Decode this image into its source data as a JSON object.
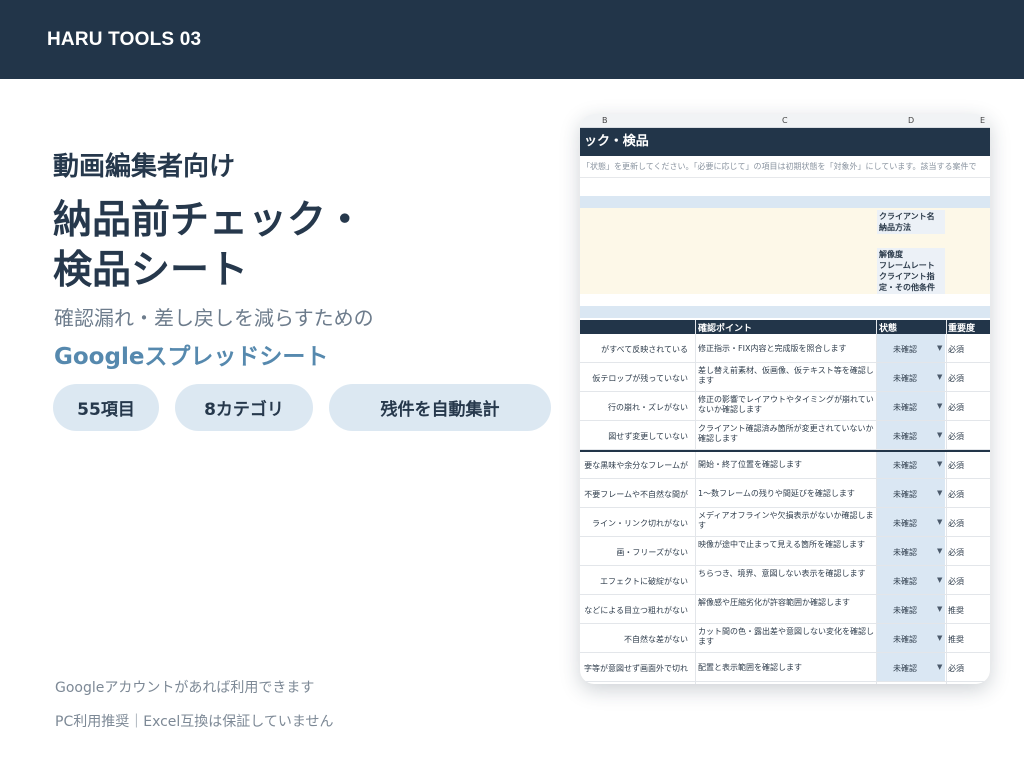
{
  "brand": "HARU TOOLS 03",
  "hero": {
    "subtitle": "動画編集者向け",
    "title_line1": "納品前チェック・",
    "title_line2": "検品シート",
    "lead": "確認漏れ・差し戻しを減らすための",
    "lead_accent": "Googleスプレッドシート"
  },
  "pills": [
    "55項目",
    "8カテゴリ",
    "残件を自動集計"
  ],
  "footer": {
    "line1": "Googleアカウントがあれば利用できます",
    "line2": "PC利用推奨｜Excel互換は保証していません"
  },
  "sheet": {
    "col_letters": [
      "B",
      "C",
      "D",
      "E"
    ],
    "banner": "ック・検品",
    "note": "「状態」を更新してください。「必要に応じて」の項目は初期状態を「対象外」にしています。該当する案件で",
    "meta": [
      "クライアント名",
      "納品方法",
      "解像度",
      "フレームレート",
      "クライアント指定・その他条件"
    ],
    "headers": {
      "point": "確認ポイント",
      "status": "状態",
      "importance": "重要度"
    },
    "rows": [
      {
        "item": "がすべて反映されている",
        "point": "修正指示・FIX内容と完成版を照合します",
        "status": "未確認",
        "importance": "必須"
      },
      {
        "item": "仮テロップが残っていない",
        "point": "差し替え前素材、仮画像、仮テキスト等を確認します",
        "status": "未確認",
        "importance": "必須"
      },
      {
        "item": "行の崩れ・ズレがない",
        "point": "修正の影響でレイアウトやタイミングが崩れていないか確認します",
        "status": "未確認",
        "importance": "必須"
      },
      {
        "item": "図せず変更していない",
        "point": "クライアント確認済み箇所が変更されていないか確認します",
        "status": "未確認",
        "importance": "必須"
      },
      {
        "item": "要な黒味や余分なフレームが",
        "point": "開始・終了位置を確認します",
        "status": "未確認",
        "importance": "必須"
      },
      {
        "item": "不要フレームや不自然な間が",
        "point": "1〜数フレームの残りや間延びを確認します",
        "status": "未確認",
        "importance": "必須"
      },
      {
        "item": "ライン・リンク切れがない",
        "point": "メディアオフラインや欠損表示がないか確認します",
        "status": "未確認",
        "importance": "必須"
      },
      {
        "item": "画・フリーズがない",
        "point": "映像が途中で止まって見える箇所を確認します",
        "status": "未確認",
        "importance": "必須"
      },
      {
        "item": "エフェクトに破綻がない",
        "point": "ちらつき、境界、意図しない表示を確認します",
        "status": "未確認",
        "importance": "必須"
      },
      {
        "item": "などによる目立つ粗れがない",
        "point": "解像感や圧縮劣化が許容範囲か確認します",
        "status": "未確認",
        "importance": "推奨"
      },
      {
        "item": "不自然な差がない",
        "point": "カット間の色・露出差や意図しない変化を確認します",
        "status": "未確認",
        "importance": "推奨"
      },
      {
        "item": "字等が意図せず画面外で切れ",
        "point": "配置と表示範囲を確認します",
        "status": "未確認",
        "importance": "必須"
      }
    ]
  }
}
